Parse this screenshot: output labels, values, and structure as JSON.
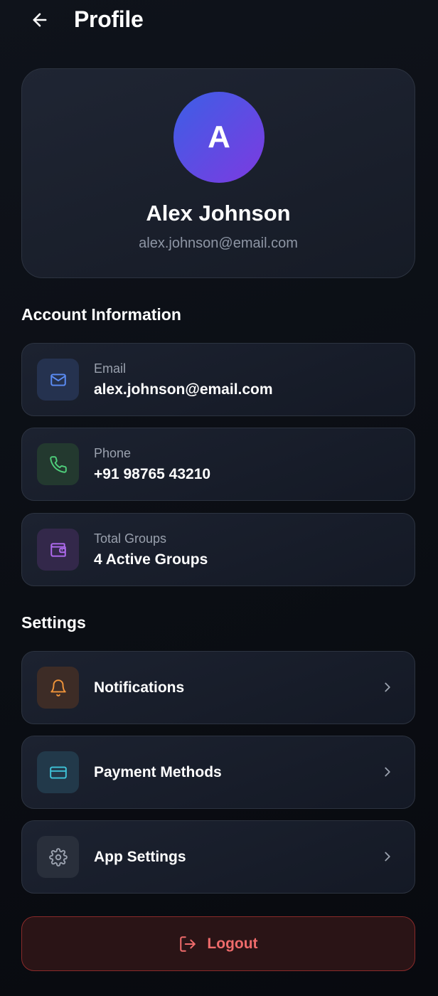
{
  "header": {
    "title": "Profile"
  },
  "profile": {
    "initial": "A",
    "name": "Alex Johnson",
    "email": "alex.johnson@email.com"
  },
  "account": {
    "title": "Account Information",
    "items": [
      {
        "label": "Email",
        "value": "alex.johnson@email.com",
        "icon": "mail-icon",
        "color": "#5b8cf5",
        "bg": "#25324f"
      },
      {
        "label": "Phone",
        "value": "+91 98765 43210",
        "icon": "phone-icon",
        "color": "#4fcf7b",
        "bg": "#23392f"
      },
      {
        "label": "Total Groups",
        "value": "4 Active Groups",
        "icon": "wallet-icon",
        "color": "#b06bf0",
        "bg": "#33284a"
      }
    ]
  },
  "settings": {
    "title": "Settings",
    "items": [
      {
        "label": "Notifications",
        "icon": "bell-icon",
        "color": "#f0943a",
        "bg": "#3d2c26"
      },
      {
        "label": "Payment Methods",
        "icon": "credit-card-icon",
        "color": "#3fc4d9",
        "bg": "#22394a"
      },
      {
        "label": "App Settings",
        "icon": "gear-icon",
        "color": "#9aa1ae",
        "bg": "#292f3b"
      }
    ]
  },
  "logout": {
    "label": "Logout",
    "icon": "logout-icon",
    "color": "#ef6b6b"
  }
}
